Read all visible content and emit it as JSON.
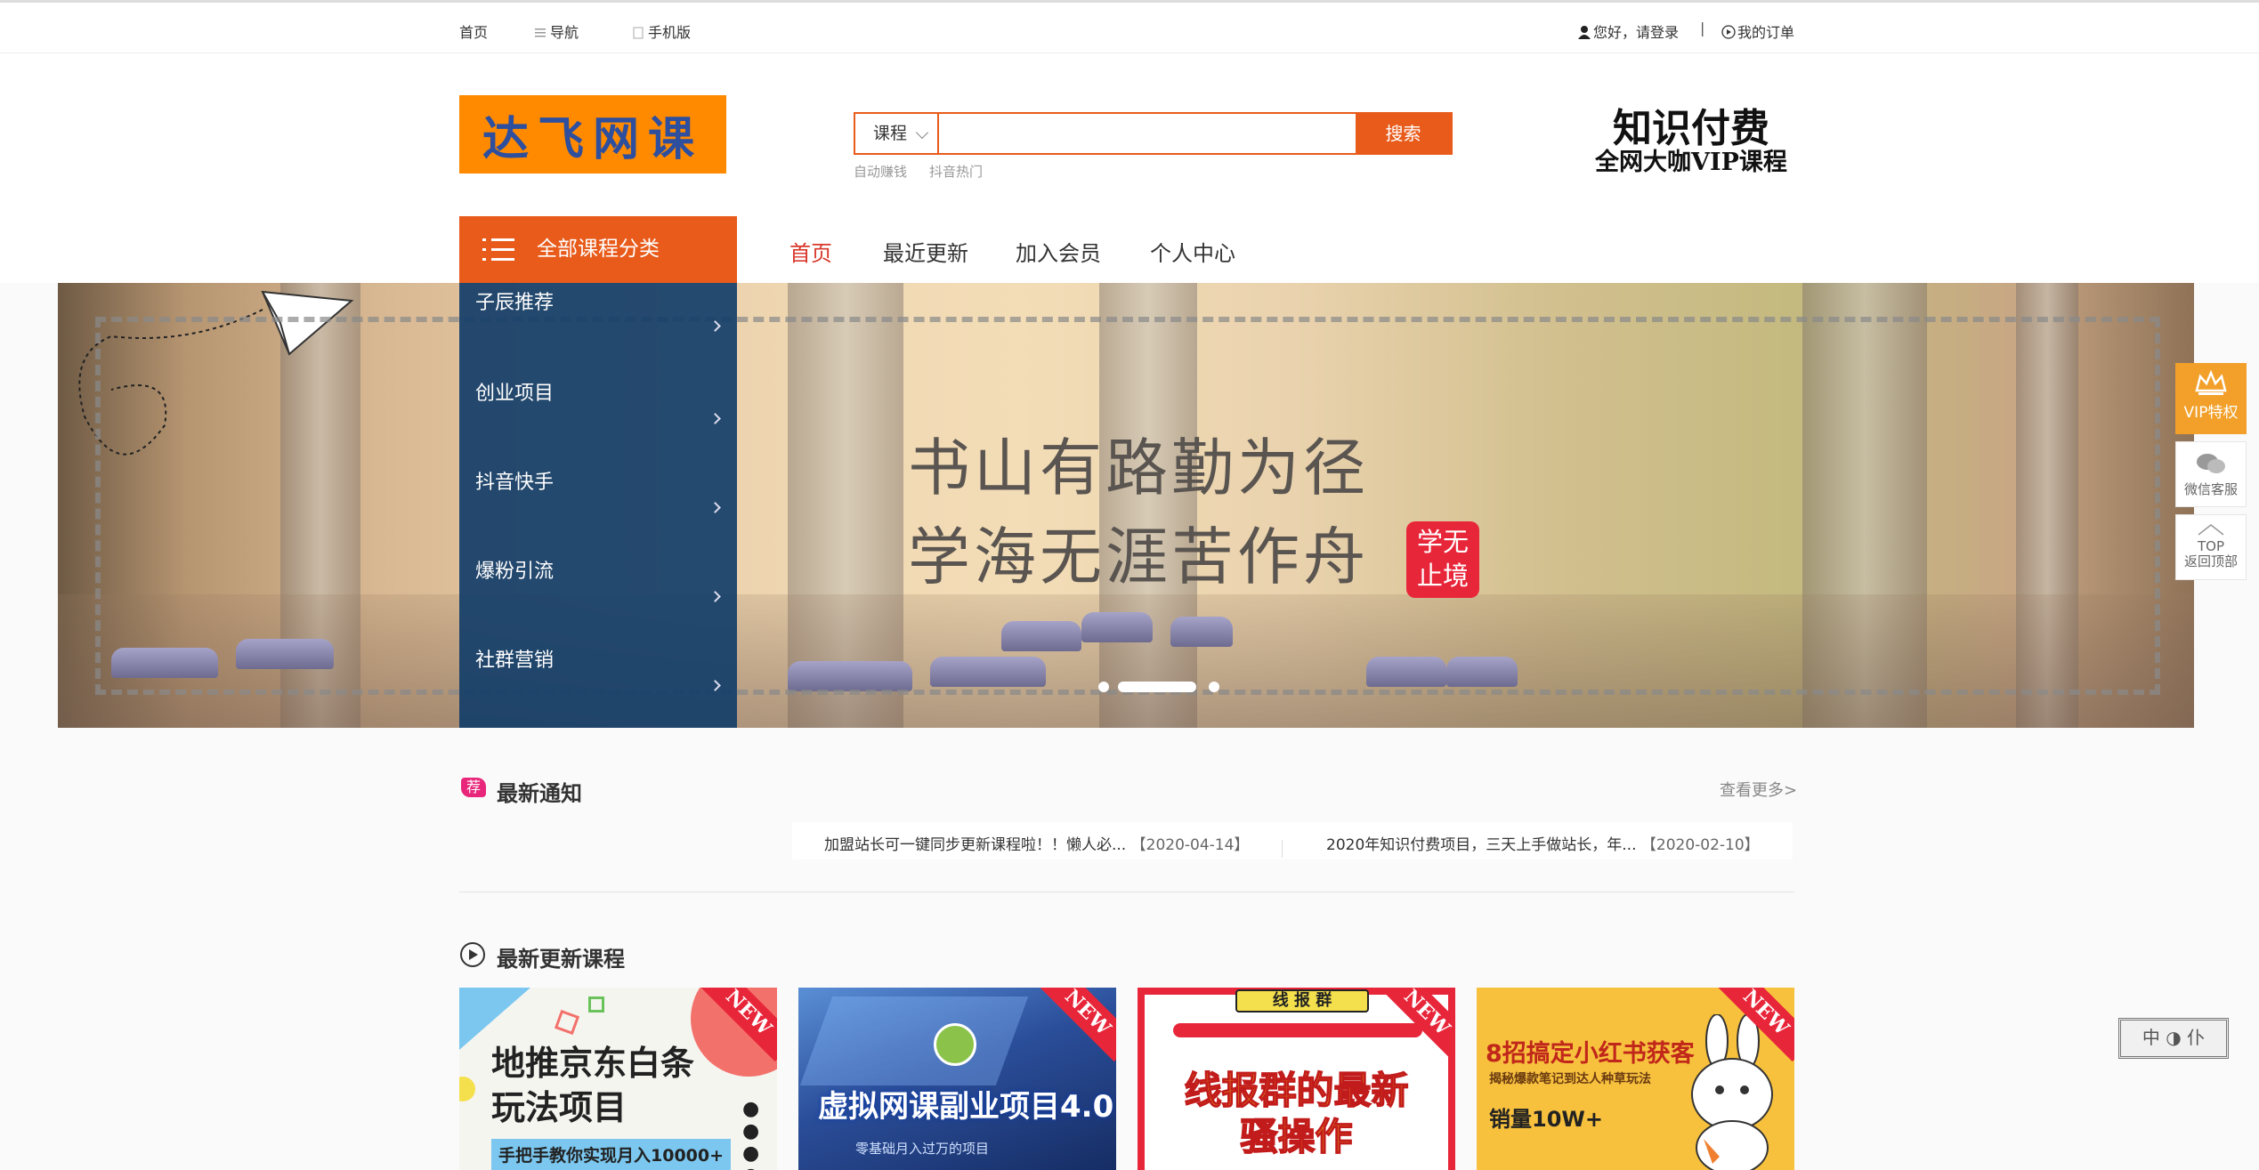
{
  "topbar": {
    "home": "首页",
    "nav": "导航",
    "mobile": "手机版",
    "login": "您好，请登录",
    "sep": "|",
    "orders": "我的订单"
  },
  "header": {
    "logo_text": "达飞网课",
    "search": {
      "category": "课程",
      "placeholder": "",
      "button": "搜索"
    },
    "hot_keywords": [
      "自动赚钱",
      "抖音热门"
    ],
    "promo_line1": "知识付费",
    "promo_line2": "全网大咖VIP课程"
  },
  "nav": {
    "all_categories": "全部课程分类",
    "links": [
      "首页",
      "最近更新",
      "加入会员",
      "个人中心"
    ]
  },
  "categories": [
    "子辰推荐",
    "创业项目",
    "抖音快手",
    "爆粉引流",
    "社群营销"
  ],
  "banner": {
    "line1": "书山有路勤为径",
    "line2": "学海无涯苦作舟",
    "stamp": "学无止境",
    "slides": 3,
    "active_slide": 2
  },
  "sidebar_tools": {
    "vip": "VIP特权",
    "wechat": "微信客服",
    "top_label": "TOP",
    "top": "返回顶部"
  },
  "notices": {
    "badge": "荐",
    "title": "最新通知",
    "more": "查看更多>",
    "items": [
      {
        "text": "加盟站长可一键同步更新课程啦！！懒人必...",
        "date": "【2020-04-14】"
      },
      {
        "text": "2020年知识付费项目，三天上手做站长，年...",
        "date": "【2020-02-10】"
      }
    ]
  },
  "courses": {
    "title": "最新更新课程",
    "cards": [
      {
        "title": "地推京东白条玩法项目",
        "title_line1": "地推京东白条",
        "title_line2": "玩法项目",
        "subtitle": "手把手教你实现月入10000+",
        "tag": "NEW"
      },
      {
        "title": "虚拟网课副业项目4.0",
        "subtitle": "零基础月入过万的项目",
        "tag": "NEW"
      },
      {
        "title": "线报群的最新骚操作",
        "header": "线 报 群",
        "title_line1": "线报群的最新",
        "title_line2": "骚操作",
        "tag": "NEW"
      },
      {
        "title": "8招搞定小红书获客",
        "subtitle": "揭秘爆款笔记到达人种草玩法",
        "extra": "销量10W+",
        "tag": "NEW"
      }
    ]
  },
  "corner_badge": "中 ◑ 仆",
  "colors": {
    "accent": "#e85b1b",
    "category_bg": "#143e69",
    "red": "#d9382b",
    "vip": "#f2a02a"
  }
}
